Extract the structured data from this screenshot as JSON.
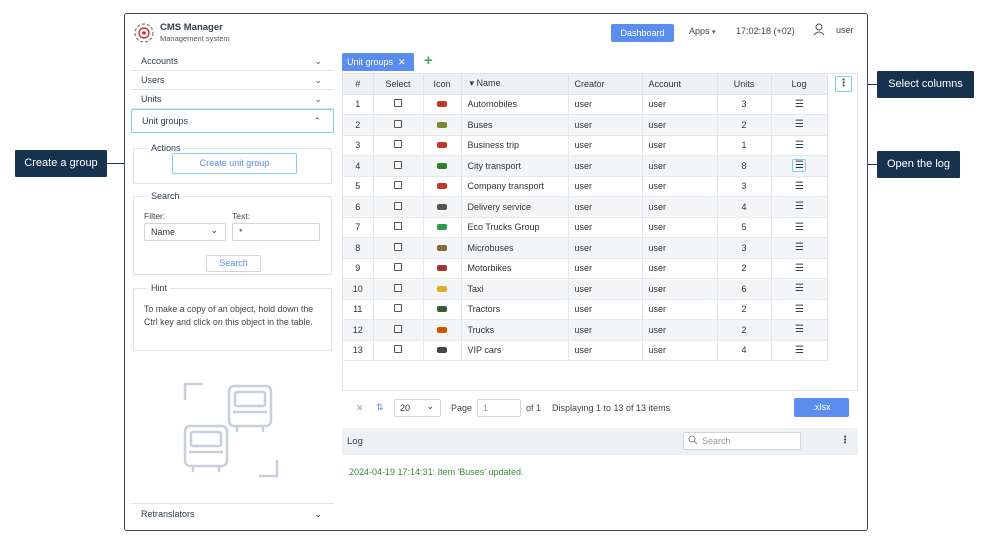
{
  "header": {
    "app_title": "CMS Manager",
    "app_subtitle": "Management system",
    "dashboard_label": "Dashboard",
    "apps_label": "Apps",
    "apps_caret": "▾",
    "clock": "17:02:18 (+02)",
    "username": "user"
  },
  "sidebar": {
    "items": [
      {
        "label": "Accounts"
      },
      {
        "label": "Users"
      },
      {
        "label": "Units"
      },
      {
        "label": "Unit groups"
      }
    ],
    "chev_down": "⌄",
    "chev_up": "⌃",
    "actions_title": "Actions",
    "create_label": "Create unit group",
    "search_title": "Search",
    "filter_label": "Filter:",
    "text_label": "Text:",
    "filter_value": "Name",
    "text_value": "*",
    "search_button": "Search",
    "hint_title": "Hint",
    "hint_text": "To make a copy of an object, hold down the Ctrl key and click on this object in the table.",
    "retranslators_label": "Retranslators"
  },
  "tabs": [
    {
      "label": "Unit groups",
      "close": "✕"
    }
  ],
  "tab_add": "+",
  "table": {
    "columns": [
      "#",
      "Select",
      "Icon",
      "▾ Name",
      "Creator",
      "Account",
      "Units",
      "Log"
    ],
    "col_menu": "⋮",
    "log_icon": "☰",
    "rows": [
      {
        "n": "1",
        "name": "Automobiles",
        "creator": "user",
        "account": "user",
        "units": "3",
        "icon_color": "#c0392b"
      },
      {
        "n": "2",
        "name": "Buses",
        "creator": "user",
        "account": "user",
        "units": "2",
        "icon_color": "#7a8a2a"
      },
      {
        "n": "3",
        "name": "Business trip",
        "creator": "user",
        "account": "user",
        "units": "1",
        "icon_color": "#c0392b"
      },
      {
        "n": "4",
        "name": "City transport",
        "creator": "user",
        "account": "user",
        "units": "8",
        "icon_color": "#2e7d32"
      },
      {
        "n": "5",
        "name": "Company transport",
        "creator": "user",
        "account": "user",
        "units": "3",
        "icon_color": "#c0392b"
      },
      {
        "n": "6",
        "name": "Delivery service",
        "creator": "user",
        "account": "user",
        "units": "4",
        "icon_color": "#555555"
      },
      {
        "n": "7",
        "name": "Eco Trucks Group",
        "creator": "user",
        "account": "user",
        "units": "5",
        "icon_color": "#2e9d4a"
      },
      {
        "n": "8",
        "name": "Microbuses",
        "creator": "user",
        "account": "user",
        "units": "3",
        "icon_color": "#8a6a3a"
      },
      {
        "n": "9",
        "name": "Motorbikes",
        "creator": "user",
        "account": "user",
        "units": "2",
        "icon_color": "#a83232"
      },
      {
        "n": "10",
        "name": "Taxi",
        "creator": "user",
        "account": "user",
        "units": "6",
        "icon_color": "#e0b020"
      },
      {
        "n": "11",
        "name": "Tractors",
        "creator": "user",
        "account": "user",
        "units": "2",
        "icon_color": "#3a5a3a"
      },
      {
        "n": "12",
        "name": "Trucks",
        "creator": "user",
        "account": "user",
        "units": "2",
        "icon_color": "#d35400"
      },
      {
        "n": "13",
        "name": "VIP cars",
        "creator": "user",
        "account": "user",
        "units": "4",
        "icon_color": "#444444"
      }
    ]
  },
  "pager": {
    "clear": "✕",
    "sort_icon": "⇅",
    "page_size": "20",
    "page_label": "Page",
    "page_value": "1",
    "of_label": "of 1",
    "display_text": "Displaying 1 to 13 of 13 items",
    "export_label": ".xlsx"
  },
  "log": {
    "title": "Log",
    "search_placeholder": "Search",
    "menu": "⋮",
    "entry": "2024-04-19 17:14:31: Item 'Buses' updated."
  },
  "callouts": {
    "create_group": "Create a group",
    "select_columns": "Select columns",
    "open_log": "Open the log"
  },
  "colors": {
    "accent": "#5b8def",
    "highlight": "#7fd0e6",
    "callout_bg": "#17324d",
    "log_entry": "#3a8a3a"
  }
}
